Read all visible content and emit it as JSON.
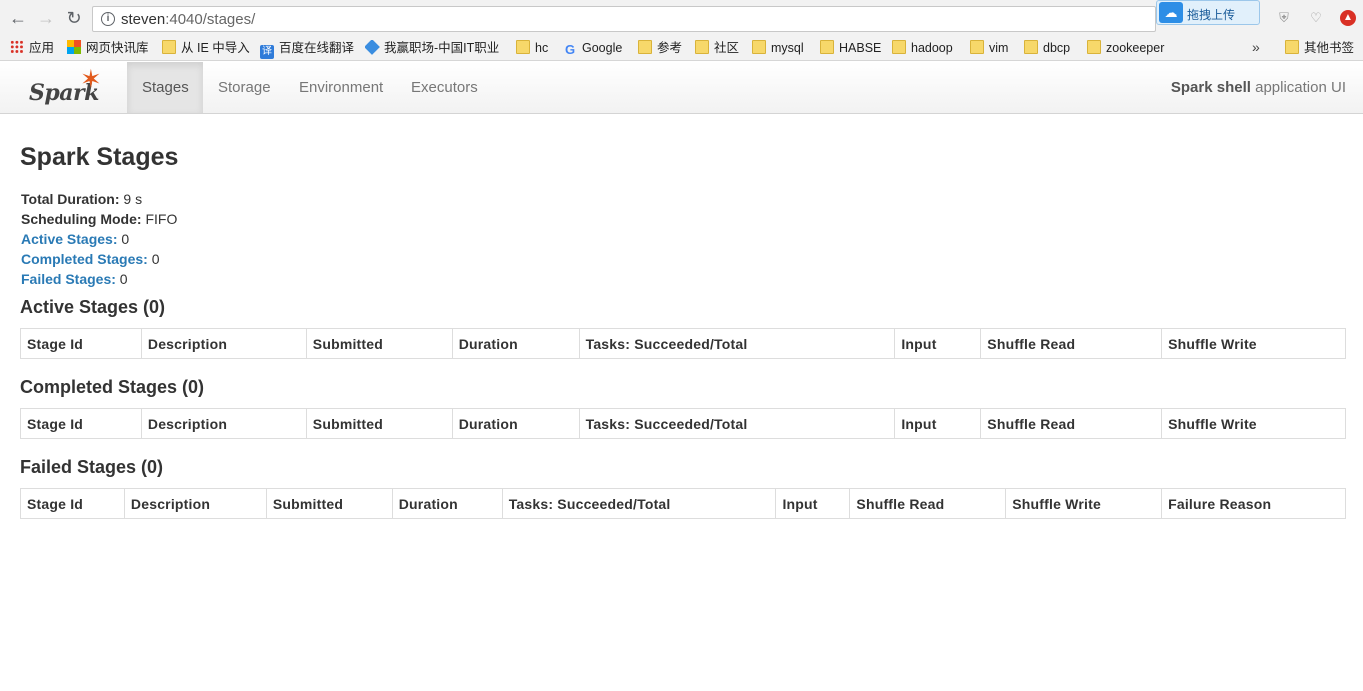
{
  "browser": {
    "url_host": "steven",
    "url_rest": ":4040/stages/",
    "upload_label": "拖拽上传",
    "bookmarks": [
      {
        "label": "应用",
        "icon": "apps-icon"
      },
      {
        "label": "网页快讯库",
        "icon": "windows-icon"
      },
      {
        "label": "从 IE 中导入",
        "icon": "folder-icon"
      },
      {
        "label": "百度在线翻译",
        "icon": "translate-icon"
      },
      {
        "label": "我赢职场-中国IT职业",
        "icon": "job-icon"
      },
      {
        "label": "hc",
        "icon": "folder-icon"
      },
      {
        "label": "Google",
        "icon": "google-icon"
      },
      {
        "label": "参考",
        "icon": "folder-icon"
      },
      {
        "label": "社区",
        "icon": "folder-icon"
      },
      {
        "label": "mysql",
        "icon": "folder-icon"
      },
      {
        "label": "HABSE",
        "icon": "folder-icon"
      },
      {
        "label": "hadoop",
        "icon": "folder-icon"
      },
      {
        "label": "vim",
        "icon": "folder-icon"
      },
      {
        "label": "dbcp",
        "icon": "folder-icon"
      },
      {
        "label": "zookeeper",
        "icon": "folder-icon"
      }
    ],
    "more_label": "»",
    "other_bookmarks": "其他书签"
  },
  "navbar": {
    "brand": "Spark",
    "tabs": [
      "Stages",
      "Storage",
      "Environment",
      "Executors"
    ],
    "active_tab": "Stages",
    "app_name": "Spark shell",
    "app_suffix": " application UI"
  },
  "page": {
    "title": "Spark Stages",
    "summary": {
      "total_duration_label": "Total Duration:",
      "total_duration": " 9 s",
      "scheduling_mode_label": "Scheduling Mode:",
      "scheduling_mode": " FIFO",
      "active_label": "Active Stages:",
      "active_count": " 0",
      "completed_label": "Completed Stages:",
      "completed_count": " 0",
      "failed_label": "Failed Stages:",
      "failed_count": " 0"
    },
    "sections": {
      "active_title": "Active Stages (0)",
      "completed_title": "Completed Stages (0)",
      "failed_title": "Failed Stages (0)"
    },
    "stage_columns": [
      "Stage Id",
      "Description",
      "Submitted",
      "Duration",
      "Tasks: Succeeded/Total",
      "Input",
      "Shuffle Read",
      "Shuffle Write"
    ],
    "failed_columns": [
      "Stage Id",
      "Description",
      "Submitted",
      "Duration",
      "Tasks: Succeeded/Total",
      "Input",
      "Shuffle Read",
      "Shuffle Write",
      "Failure Reason"
    ]
  }
}
